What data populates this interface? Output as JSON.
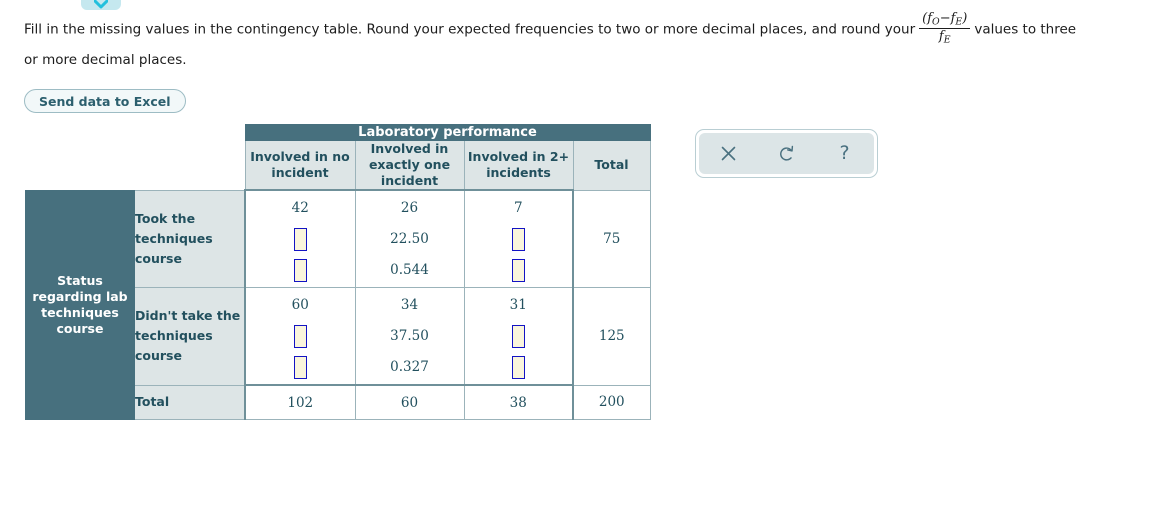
{
  "prompt": {
    "part1": "Fill in the missing values in the contingency table. Round your expected frequencies to two or more decimal places, and round your",
    "formula": {
      "numerator_open": "(",
      "numerator_fo": "f",
      "numerator_fo_sub": "O",
      "numerator_minus": "−",
      "numerator_fe": "f",
      "numerator_fe_sub": "E",
      "numerator_close": ")",
      "denominator_f": "f",
      "denominator_sub": "E"
    },
    "part2": "values to three",
    "part3": "or more decimal places."
  },
  "excel_button": {
    "label": "Send data to Excel"
  },
  "tool_widget": {
    "buttons": [
      {
        "name": "clear",
        "glyph": "×"
      },
      {
        "name": "undo",
        "glyph": "↺"
      },
      {
        "name": "help",
        "glyph": "?"
      }
    ]
  },
  "table": {
    "column_group_header": "Laboratory performance",
    "row_group_header": "Status regarding lab techniques course",
    "column_headers": [
      "Involved in no incident",
      "Involved in exactly one incident",
      "Involved in 2+ incidents",
      "Total"
    ],
    "rows": [
      {
        "label": "Took the techniques course",
        "cells": [
          {
            "observed": "42",
            "expected": "",
            "contrib": "",
            "expected_blank": true,
            "contrib_blank": true
          },
          {
            "observed": "26",
            "expected": "22.50",
            "contrib": "0.544",
            "expected_blank": false,
            "contrib_blank": false
          },
          {
            "observed": "7",
            "expected": "",
            "contrib": "",
            "expected_blank": true,
            "contrib_blank": true
          }
        ],
        "total": "75"
      },
      {
        "label": "Didn't take the techniques course",
        "cells": [
          {
            "observed": "60",
            "expected": "",
            "contrib": "",
            "expected_blank": true,
            "contrib_blank": true
          },
          {
            "observed": "34",
            "expected": "37.50",
            "contrib": "0.327",
            "expected_blank": false,
            "contrib_blank": false
          },
          {
            "observed": "31",
            "expected": "",
            "contrib": "",
            "expected_blank": true,
            "contrib_blank": true
          }
        ],
        "total": "125"
      }
    ],
    "total_row": {
      "label": "Total",
      "values": [
        "102",
        "60",
        "38",
        "200"
      ]
    }
  },
  "colors": {
    "header_dark": "#47707e",
    "header_light": "#dde5e6",
    "text_teal": "#22505e",
    "input_fill": "#faf5dc",
    "input_border": "#1313c4",
    "accent_cyan": "#22c0dd"
  }
}
